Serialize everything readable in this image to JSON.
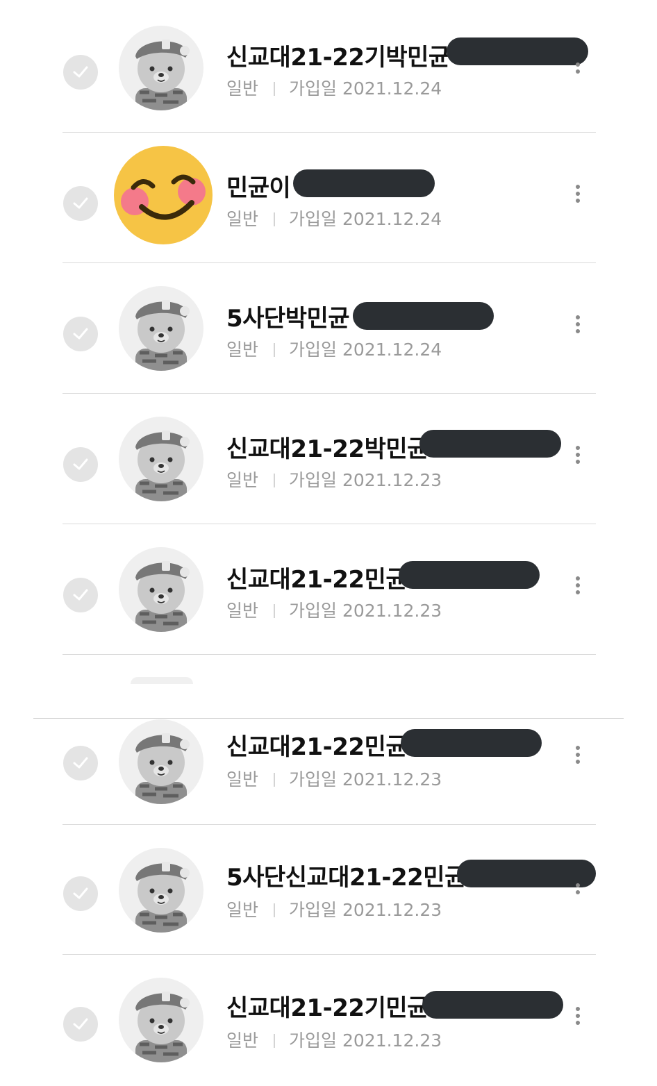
{
  "members": [
    {
      "name": "신교대21-22기박민균",
      "type": "일반",
      "joined_label": "가입일",
      "joined_date": "2021.12.24",
      "avatar": "soldier-bear",
      "redacted": true
    },
    {
      "name": "민균이",
      "type": "일반",
      "joined_label": "가입일",
      "joined_date": "2021.12.24",
      "avatar": "smiling-emoji",
      "redacted": true
    },
    {
      "name": "5사단박민균",
      "type": "일반",
      "joined_label": "가입일",
      "joined_date": "2021.12.24",
      "avatar": "soldier-bear",
      "redacted": true
    },
    {
      "name": "신교대21-22박민균",
      "type": "일반",
      "joined_label": "가입일",
      "joined_date": "2021.12.23",
      "avatar": "soldier-bear",
      "redacted": true
    },
    {
      "name": "신교대21-22민균",
      "type": "일반",
      "joined_label": "가입일",
      "joined_date": "2021.12.23",
      "avatar": "soldier-bear",
      "redacted": true
    },
    {
      "name": "신교대21-22민균",
      "type": "일반",
      "joined_label": "가입일",
      "joined_date": "2021.12.23",
      "avatar": "soldier-bear",
      "redacted": true
    },
    {
      "name": "5사단신교대21-22민균",
      "type": "일반",
      "joined_label": "가입일",
      "joined_date": "2021.12.23",
      "avatar": "soldier-bear",
      "redacted": true
    },
    {
      "name": "신교대21-22기민균",
      "type": "일반",
      "joined_label": "가입일",
      "joined_date": "2021.12.23",
      "avatar": "soldier-bear",
      "redacted": true
    }
  ],
  "icons": {
    "check": "check-icon",
    "more": "more-vertical-icon"
  },
  "colors": {
    "redaction": "#2b2f33",
    "meta_text": "#9a9a9a",
    "divider": "#d9d9d9",
    "check_bg": "#e4e4e4",
    "emoji_face": "#f6c445",
    "emoji_cheek": "#f47a8a"
  }
}
